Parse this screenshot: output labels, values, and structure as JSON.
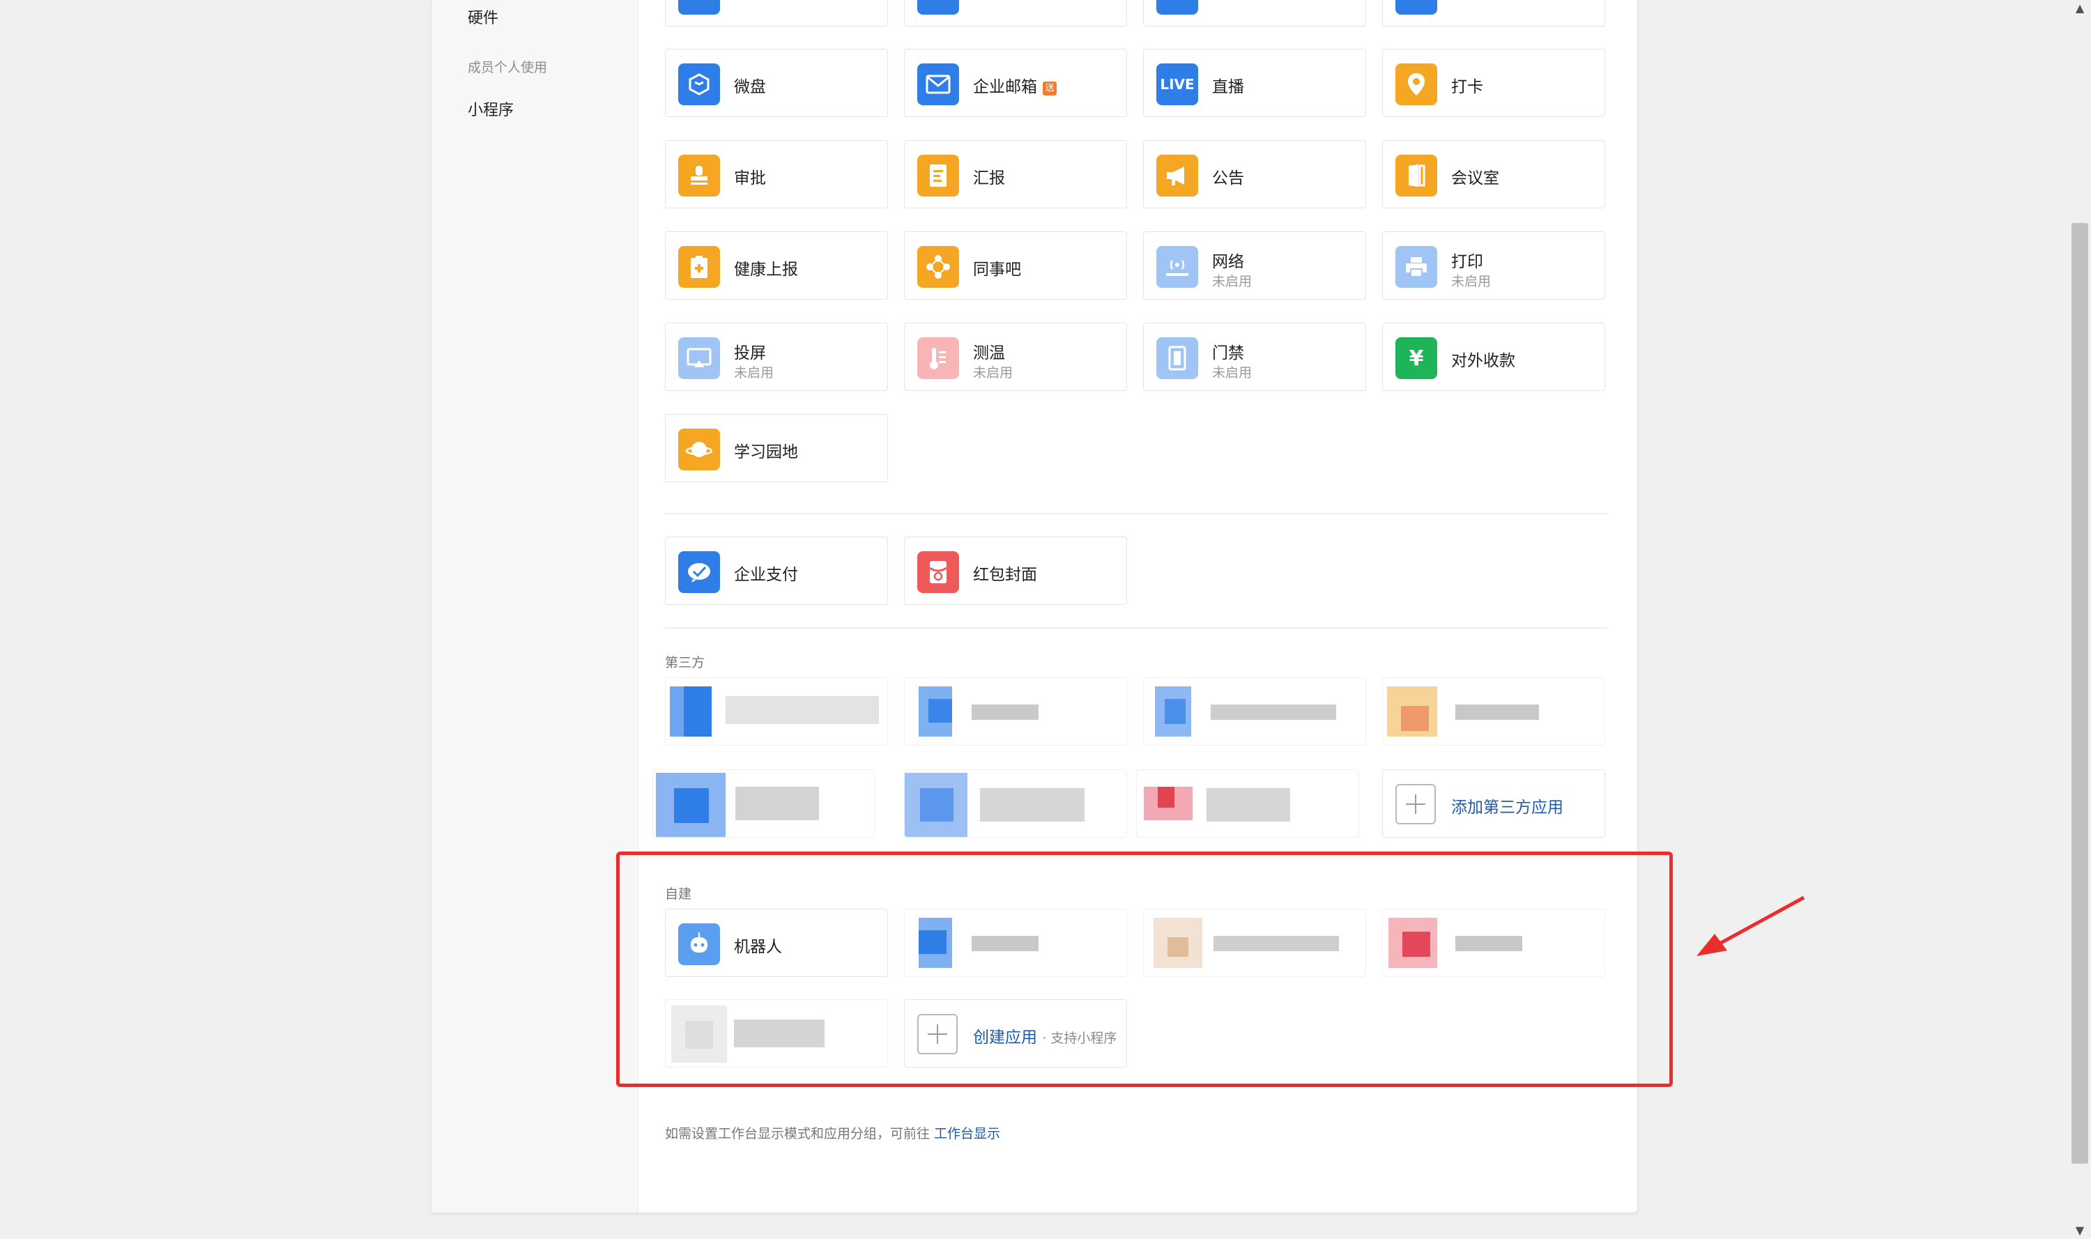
{
  "sidebar": {
    "items": [
      {
        "label": "硬件"
      },
      {
        "group": "成员个人使用"
      },
      {
        "label": "小程序"
      }
    ]
  },
  "apps": [
    {
      "name": "微盘",
      "icon": "cube-icon",
      "color": "#2f7ee8"
    },
    {
      "name": "企业邮箱",
      "icon": "mail-icon",
      "color": "#2f7ee8",
      "badge": "送"
    },
    {
      "name": "直播",
      "icon": "live-icon",
      "color": "#2f7ee8",
      "icon_text": "LIVE"
    },
    {
      "name": "打卡",
      "icon": "location-pin-icon",
      "color": "#f5a623"
    },
    {
      "name": "审批",
      "icon": "stamp-icon",
      "color": "#f5a623"
    },
    {
      "name": "汇报",
      "icon": "report-icon",
      "color": "#f5a623"
    },
    {
      "name": "公告",
      "icon": "megaphone-icon",
      "color": "#f5a623"
    },
    {
      "name": "会议室",
      "icon": "door-icon",
      "color": "#f5a623"
    },
    {
      "name": "健康上报",
      "icon": "health-report-icon",
      "color": "#f5a623"
    },
    {
      "name": "同事吧",
      "icon": "network-icon",
      "color": "#f5a623"
    },
    {
      "name": "网络",
      "status": "未启用",
      "icon": "wifi-icon",
      "color": "#2f7ee8"
    },
    {
      "name": "打印",
      "status": "未启用",
      "icon": "printer-icon",
      "color": "#2f7ee8"
    },
    {
      "name": "投屏",
      "status": "未启用",
      "icon": "screen-cast-icon",
      "color": "#2f7ee8"
    },
    {
      "name": "测温",
      "status": "未启用",
      "icon": "thermometer-icon",
      "color": "#f25c5c"
    },
    {
      "name": "门禁",
      "status": "未启用",
      "icon": "gate-icon",
      "color": "#2f7ee8"
    },
    {
      "name": "对外收款",
      "icon": "yuan-icon",
      "color": "#1fb35a",
      "icon_text": "¥"
    },
    {
      "name": "学习园地",
      "icon": "planet-icon",
      "color": "#f5a623"
    }
  ],
  "payment_apps": [
    {
      "name": "企业支付",
      "icon": "wechat-pay-icon",
      "color": "#2f7ee8"
    },
    {
      "name": "红包封面",
      "icon": "red-envelope-icon",
      "color": "#ee5a5a"
    }
  ],
  "third_party": {
    "label": "第三方",
    "add_label": "添加第三方应用"
  },
  "custom": {
    "label": "自建",
    "robot_name": "机器人",
    "create_label": "创建应用",
    "create_sub": "· 支持小程序"
  },
  "footer": {
    "text": "如需设置工作台显示模式和应用分组，可前往",
    "link": "工作台显示"
  }
}
